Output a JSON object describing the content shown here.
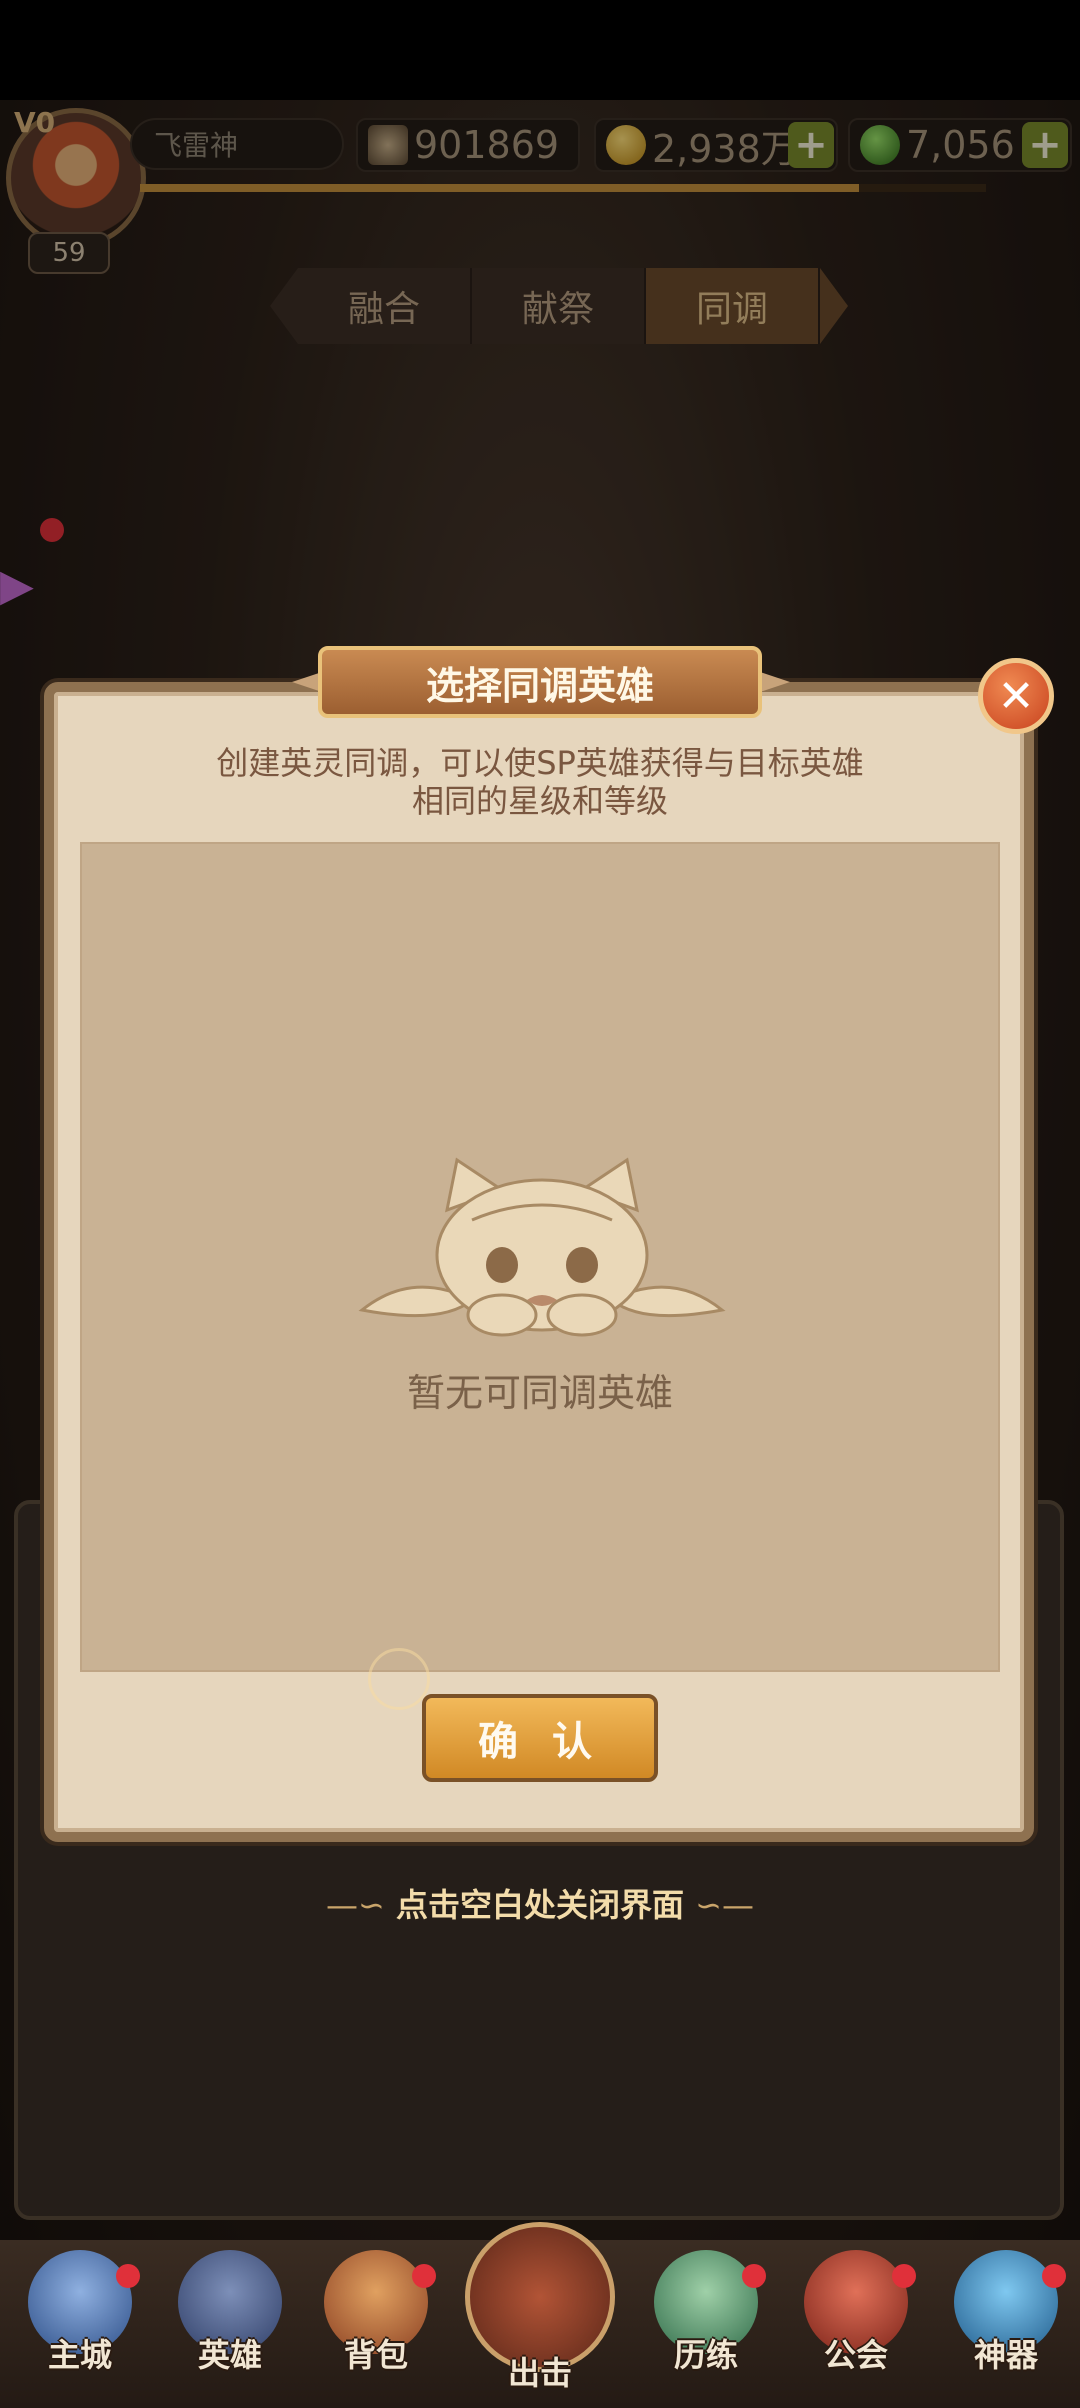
{
  "status_bar": {},
  "player": {
    "vip": "V0",
    "name": "飞雷神",
    "level": "59",
    "power": "901869",
    "gold": "2,938万",
    "potion": "7,056",
    "xp_fraction": 0.85
  },
  "tabs": [
    {
      "label": "融合",
      "active": false
    },
    {
      "label": "献祭",
      "active": false
    },
    {
      "label": "同调",
      "active": true
    }
  ],
  "modal": {
    "title": "选择同调英雄",
    "description_line1": "创建英灵同调，可以使SP英雄获得与目标英雄",
    "description_line2": "相同的星级和等级",
    "empty_text": "暂无可同调英雄",
    "confirm_label": "确 认",
    "close_symbol": "✕"
  },
  "close_hint": "点击空白处关闭界面",
  "bottom_nav": [
    {
      "label": "主城",
      "badge": true,
      "icon": "castle-icon"
    },
    {
      "label": "英雄",
      "badge": false,
      "icon": "helmet-icon"
    },
    {
      "label": "背包",
      "badge": true,
      "icon": "backpack-icon"
    },
    {
      "label": "出击",
      "badge": false,
      "icon": "crossed-swords-icon"
    },
    {
      "label": "历练",
      "badge": true,
      "icon": "training-icon"
    },
    {
      "label": "公会",
      "badge": true,
      "icon": "guild-banner-icon"
    },
    {
      "label": "神器",
      "badge": true,
      "icon": "artifact-orb-icon"
    }
  ],
  "colors": {
    "accent_gold": "#d18925",
    "panel_parchment": "#e6d6bd",
    "badge_red": "#e0303a"
  }
}
